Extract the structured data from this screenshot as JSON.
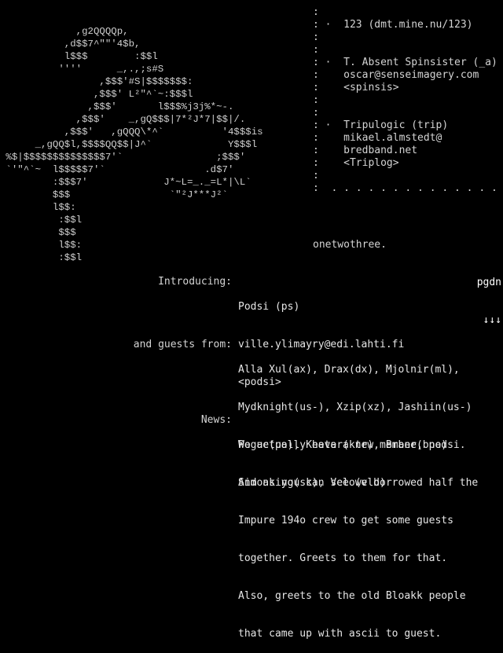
{
  "ascii_art": {
    "lines": [
      "",
      "",
      "             ,g2QQQQp,",
      "           ,d$$7^\"\"'4$b,",
      "           l$$$        :$$l",
      "          ''''      _,.,;s#S",
      "                 ,$$$'#S|$$$$$$$:",
      "                ,$$$' L²\"^`~:$$$l",
      "               ,$$$'       l$$$%j3j%*~-.",
      "             ,$$$'    _,gQ$$$|7*²J*7|$$|/.",
      "           ,$$$'   ,gQQQ\\*^`          '4$$$is",
      "      _,gQQ$l,$$$$QQ$$|J^`             Y$$$l",
      " %$|$$$$$$$$$$$$$$7'`                ;$$$'",
      " `'\"^`~  l$$$$$7'`                 .d$7'",
      "         :$$$7'             J*~L=_._=L*|\\L`",
      "         $$$                 `\"²J***J²`",
      "         l$$:",
      "          :$$l",
      "          $$$",
      "          l$$:",
      "          :$$l"
    ]
  },
  "info": {
    "separator": ":",
    "bullet": "·",
    "entries": [
      {
        "name": "123 (dmt.mine.nu/123)",
        "lines": []
      },
      {
        "name": "T. Absent Spinsister (_a)",
        "lines": [
          "oscar@senseimagery.com",
          "<spinsis>"
        ]
      },
      {
        "name": "Tripulogic (trip)",
        "lines": [
          "mikael.almstedt@",
          "bredband.net",
          "<Triplog>"
        ]
      }
    ],
    "dots_line": ":  . . . . . . . . . . . . . . . ."
  },
  "group_logo": "onetwothree.",
  "pager": {
    "label": "pgdn",
    "arrows": "↓↓↓"
  },
  "sections": {
    "introducing": {
      "label": "Introducing:",
      "lines": [
        "Podsi (ps)",
        "ville.ylimayry@edi.lahti.fi",
        "<podsi>"
      ]
    },
    "guests": {
      "label": "and guests from:",
      "lines": [
        "Alla Xul(ax), Drax(dx), Mjolnir(ml),",
        "Mydknight(us-), Xzip(xz), Jashiin(us-)",
        "Pogue(po), Keetar(ktr), Brane(bne)",
        "Simonking(sk), Velo(vld)"
      ]
    },
    "news": {
      "label": "News:",
      "lines": [
        "We actually have a new member, podsi.",
        "And as you can see we borrowed half the",
        "Impure 194o crew to get some guests",
        "together. Greets to them for that.",
        "Also, greets to the old Bloakk people",
        "that came up with ascii to guest."
      ]
    }
  },
  "colors": {
    "background": "#000000",
    "text": "#d4d4d4",
    "highlight": "#ffffff"
  }
}
